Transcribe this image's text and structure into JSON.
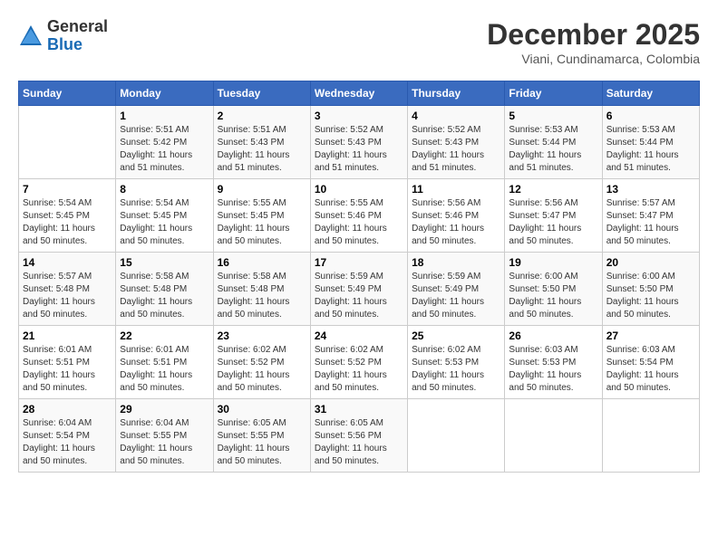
{
  "logo": {
    "general": "General",
    "blue": "Blue"
  },
  "title": "December 2025",
  "subtitle": "Viani, Cundinamarca, Colombia",
  "weekdays": [
    "Sunday",
    "Monday",
    "Tuesday",
    "Wednesday",
    "Thursday",
    "Friday",
    "Saturday"
  ],
  "weeks": [
    [
      {
        "day": "",
        "sunrise": "",
        "sunset": "",
        "daylight": ""
      },
      {
        "day": "1",
        "sunrise": "Sunrise: 5:51 AM",
        "sunset": "Sunset: 5:42 PM",
        "daylight": "Daylight: 11 hours and 51 minutes."
      },
      {
        "day": "2",
        "sunrise": "Sunrise: 5:51 AM",
        "sunset": "Sunset: 5:43 PM",
        "daylight": "Daylight: 11 hours and 51 minutes."
      },
      {
        "day": "3",
        "sunrise": "Sunrise: 5:52 AM",
        "sunset": "Sunset: 5:43 PM",
        "daylight": "Daylight: 11 hours and 51 minutes."
      },
      {
        "day": "4",
        "sunrise": "Sunrise: 5:52 AM",
        "sunset": "Sunset: 5:43 PM",
        "daylight": "Daylight: 11 hours and 51 minutes."
      },
      {
        "day": "5",
        "sunrise": "Sunrise: 5:53 AM",
        "sunset": "Sunset: 5:44 PM",
        "daylight": "Daylight: 11 hours and 51 minutes."
      },
      {
        "day": "6",
        "sunrise": "Sunrise: 5:53 AM",
        "sunset": "Sunset: 5:44 PM",
        "daylight": "Daylight: 11 hours and 51 minutes."
      }
    ],
    [
      {
        "day": "7",
        "sunrise": "Sunrise: 5:54 AM",
        "sunset": "Sunset: 5:45 PM",
        "daylight": "Daylight: 11 hours and 50 minutes."
      },
      {
        "day": "8",
        "sunrise": "Sunrise: 5:54 AM",
        "sunset": "Sunset: 5:45 PM",
        "daylight": "Daylight: 11 hours and 50 minutes."
      },
      {
        "day": "9",
        "sunrise": "Sunrise: 5:55 AM",
        "sunset": "Sunset: 5:45 PM",
        "daylight": "Daylight: 11 hours and 50 minutes."
      },
      {
        "day": "10",
        "sunrise": "Sunrise: 5:55 AM",
        "sunset": "Sunset: 5:46 PM",
        "daylight": "Daylight: 11 hours and 50 minutes."
      },
      {
        "day": "11",
        "sunrise": "Sunrise: 5:56 AM",
        "sunset": "Sunset: 5:46 PM",
        "daylight": "Daylight: 11 hours and 50 minutes."
      },
      {
        "day": "12",
        "sunrise": "Sunrise: 5:56 AM",
        "sunset": "Sunset: 5:47 PM",
        "daylight": "Daylight: 11 hours and 50 minutes."
      },
      {
        "day": "13",
        "sunrise": "Sunrise: 5:57 AM",
        "sunset": "Sunset: 5:47 PM",
        "daylight": "Daylight: 11 hours and 50 minutes."
      }
    ],
    [
      {
        "day": "14",
        "sunrise": "Sunrise: 5:57 AM",
        "sunset": "Sunset: 5:48 PM",
        "daylight": "Daylight: 11 hours and 50 minutes."
      },
      {
        "day": "15",
        "sunrise": "Sunrise: 5:58 AM",
        "sunset": "Sunset: 5:48 PM",
        "daylight": "Daylight: 11 hours and 50 minutes."
      },
      {
        "day": "16",
        "sunrise": "Sunrise: 5:58 AM",
        "sunset": "Sunset: 5:48 PM",
        "daylight": "Daylight: 11 hours and 50 minutes."
      },
      {
        "day": "17",
        "sunrise": "Sunrise: 5:59 AM",
        "sunset": "Sunset: 5:49 PM",
        "daylight": "Daylight: 11 hours and 50 minutes."
      },
      {
        "day": "18",
        "sunrise": "Sunrise: 5:59 AM",
        "sunset": "Sunset: 5:49 PM",
        "daylight": "Daylight: 11 hours and 50 minutes."
      },
      {
        "day": "19",
        "sunrise": "Sunrise: 6:00 AM",
        "sunset": "Sunset: 5:50 PM",
        "daylight": "Daylight: 11 hours and 50 minutes."
      },
      {
        "day": "20",
        "sunrise": "Sunrise: 6:00 AM",
        "sunset": "Sunset: 5:50 PM",
        "daylight": "Daylight: 11 hours and 50 minutes."
      }
    ],
    [
      {
        "day": "21",
        "sunrise": "Sunrise: 6:01 AM",
        "sunset": "Sunset: 5:51 PM",
        "daylight": "Daylight: 11 hours and 50 minutes."
      },
      {
        "day": "22",
        "sunrise": "Sunrise: 6:01 AM",
        "sunset": "Sunset: 5:51 PM",
        "daylight": "Daylight: 11 hours and 50 minutes."
      },
      {
        "day": "23",
        "sunrise": "Sunrise: 6:02 AM",
        "sunset": "Sunset: 5:52 PM",
        "daylight": "Daylight: 11 hours and 50 minutes."
      },
      {
        "day": "24",
        "sunrise": "Sunrise: 6:02 AM",
        "sunset": "Sunset: 5:52 PM",
        "daylight": "Daylight: 11 hours and 50 minutes."
      },
      {
        "day": "25",
        "sunrise": "Sunrise: 6:02 AM",
        "sunset": "Sunset: 5:53 PM",
        "daylight": "Daylight: 11 hours and 50 minutes."
      },
      {
        "day": "26",
        "sunrise": "Sunrise: 6:03 AM",
        "sunset": "Sunset: 5:53 PM",
        "daylight": "Daylight: 11 hours and 50 minutes."
      },
      {
        "day": "27",
        "sunrise": "Sunrise: 6:03 AM",
        "sunset": "Sunset: 5:54 PM",
        "daylight": "Daylight: 11 hours and 50 minutes."
      }
    ],
    [
      {
        "day": "28",
        "sunrise": "Sunrise: 6:04 AM",
        "sunset": "Sunset: 5:54 PM",
        "daylight": "Daylight: 11 hours and 50 minutes."
      },
      {
        "day": "29",
        "sunrise": "Sunrise: 6:04 AM",
        "sunset": "Sunset: 5:55 PM",
        "daylight": "Daylight: 11 hours and 50 minutes."
      },
      {
        "day": "30",
        "sunrise": "Sunrise: 6:05 AM",
        "sunset": "Sunset: 5:55 PM",
        "daylight": "Daylight: 11 hours and 50 minutes."
      },
      {
        "day": "31",
        "sunrise": "Sunrise: 6:05 AM",
        "sunset": "Sunset: 5:56 PM",
        "daylight": "Daylight: 11 hours and 50 minutes."
      },
      {
        "day": "",
        "sunrise": "",
        "sunset": "",
        "daylight": ""
      },
      {
        "day": "",
        "sunrise": "",
        "sunset": "",
        "daylight": ""
      },
      {
        "day": "",
        "sunrise": "",
        "sunset": "",
        "daylight": ""
      }
    ]
  ]
}
